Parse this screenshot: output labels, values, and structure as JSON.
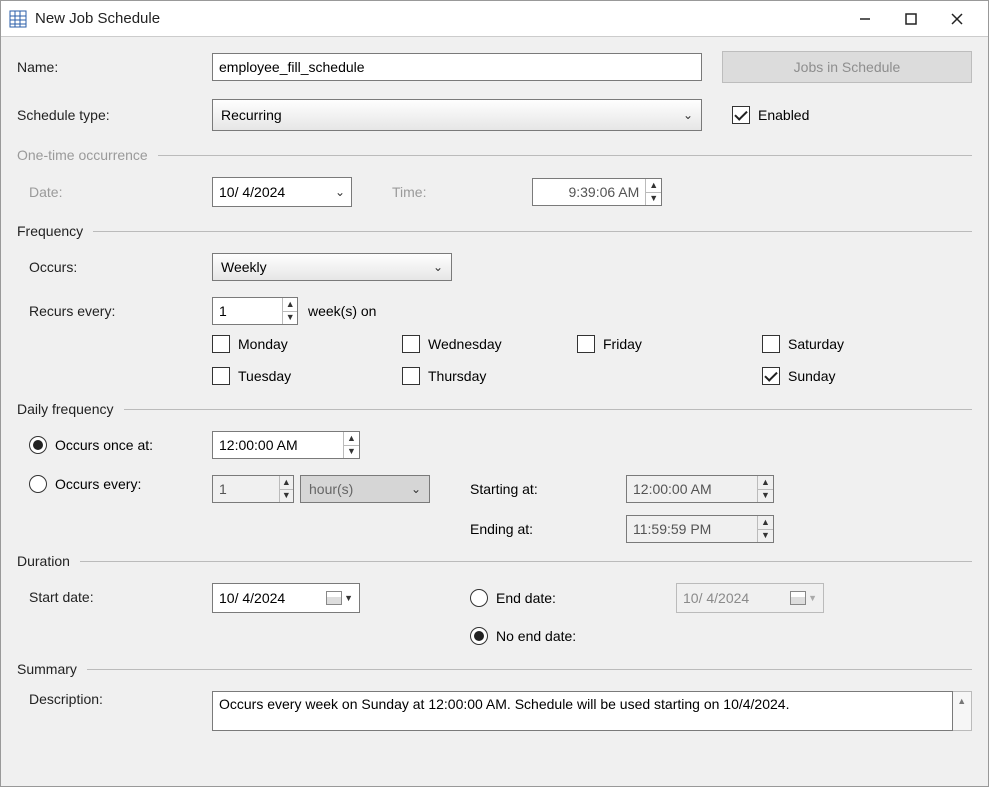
{
  "window": {
    "title": "New Job Schedule"
  },
  "form": {
    "name_label": "Name:",
    "name_value": "employee_fill_schedule",
    "jobs_in_schedule_label": "Jobs in Schedule",
    "schedule_type_label": "Schedule type:",
    "schedule_type_value": "Recurring",
    "enabled_label": "Enabled",
    "enabled_checked": true
  },
  "one_time": {
    "legend": "One-time occurrence",
    "date_label": "Date:",
    "date_value": "10/  4/2024",
    "time_label": "Time:",
    "time_value": "9:39:06 AM"
  },
  "frequency": {
    "legend": "Frequency",
    "occurs_label": "Occurs:",
    "occurs_value": "Weekly",
    "recurs_label": "Recurs every:",
    "recurs_value": "1",
    "recurs_unit": "week(s) on",
    "days": {
      "monday": "Monday",
      "tuesday": "Tuesday",
      "wednesday": "Wednesday",
      "thursday": "Thursday",
      "friday": "Friday",
      "saturday": "Saturday",
      "sunday": "Sunday"
    },
    "days_checked": {
      "sunday": true
    }
  },
  "daily": {
    "legend": "Daily frequency",
    "occurs_once_label": "Occurs once at:",
    "occurs_once_value": "12:00:00 AM",
    "occurs_every_label": "Occurs every:",
    "occurs_every_value": "1",
    "occurs_every_unit": "hour(s)",
    "starting_label": "Starting at:",
    "starting_value": "12:00:00 AM",
    "ending_label": "Ending at:",
    "ending_value": "11:59:59 PM"
  },
  "duration": {
    "legend": "Duration",
    "start_label": "Start date:",
    "start_value": "10/  4/2024",
    "end_date_label": "End date:",
    "end_date_value": "10/  4/2024",
    "no_end_label": "No end date:"
  },
  "summary": {
    "legend": "Summary",
    "description_label": "Description:",
    "description_value": "Occurs every week on Sunday at 12:00:00 AM. Schedule will be used starting on 10/4/2024."
  }
}
